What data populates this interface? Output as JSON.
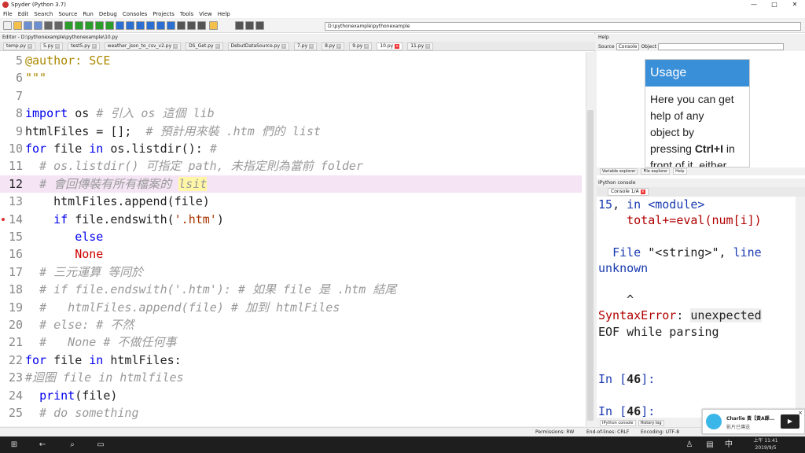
{
  "window": {
    "title": "Spyder (Python 3.7)",
    "controls": [
      "—",
      "□",
      "✕"
    ]
  },
  "menu": [
    "File",
    "Edit",
    "Search",
    "Source",
    "Run",
    "Debug",
    "Consoles",
    "Projects",
    "Tools",
    "View",
    "Help"
  ],
  "toolbar": {
    "path": "D:\\pythonexample\\pythonexample",
    "icons": [
      "new-file",
      "open",
      "save",
      "save-all",
      "browse-tabs",
      "at",
      "run",
      "run-cell",
      "run-cell-advance",
      "run-selection",
      "re-run",
      "debug",
      "step",
      "step-into",
      "step-return",
      "continue",
      "stop",
      "maximize",
      "fullscreen",
      "preferences",
      "python-path",
      "back",
      "forward",
      "up"
    ]
  },
  "editor": {
    "pane_title": "Editor - D:\\pythonexample\\pythonexample\\10.py",
    "tabs": [
      {
        "label": "temp.py",
        "active": false
      },
      {
        "label": "5.py",
        "active": false
      },
      {
        "label": "test5.py",
        "active": false
      },
      {
        "label": "weather_json_to_csv_v2.py",
        "active": false
      },
      {
        "label": "DS_Get.py",
        "active": false
      },
      {
        "label": "DebutDataSource.py",
        "active": false
      },
      {
        "label": "7.py",
        "active": false
      },
      {
        "label": "8.py",
        "active": false
      },
      {
        "label": "9.py",
        "active": false
      },
      {
        "label": "10.py",
        "active": true
      },
      {
        "label": "11.py",
        "active": false
      }
    ],
    "lines": [
      {
        "n": "5",
        "html": "<span class='dec'>@author: SCE</span>"
      },
      {
        "n": "6",
        "html": "<span class='dec'>\"\"\"</span>"
      },
      {
        "n": "7",
        "html": ""
      },
      {
        "n": "8",
        "html": "<span class='kw'>import</span> os <span class='cm'># 引入 os 這個 lib</span>"
      },
      {
        "n": "9",
        "html": "htmlFiles = [];  <span class='cm'># 預計用來裝 .htm 們的 list</span>"
      },
      {
        "n": "10",
        "html": "<span class='kw'>for</span> file <span class='kw'>in</span> os.listdir(): <span class='cm'>#</span>"
      },
      {
        "n": "11",
        "html": "  <span class='cm'># os.listdir() 可指定 path, 未指定則為當前 folder</span>"
      },
      {
        "n": "12",
        "html": "  <span class='cm'># 會回傳裝有所有檔案的 <span class='lsit'>lsit</span></span>",
        "hl": true
      },
      {
        "n": "13",
        "html": "    htmlFiles.append(file)"
      },
      {
        "n": "14",
        "html": "    <span class='kw'>if</span> file.endswith(<span class='str'>'.htm'</span>)",
        "bp": true
      },
      {
        "n": "15",
        "html": "       <span class='kw'>else</span>"
      },
      {
        "n": "16",
        "html": "       <span class='var'>None</span>"
      },
      {
        "n": "17",
        "html": "  <span class='cm'># 三元運算 等同於</span>"
      },
      {
        "n": "18",
        "html": "  <span class='cm'># if file.endswith('.htm'): # 如果 file 是 .htm 結尾</span>"
      },
      {
        "n": "19",
        "html": "  <span class='cm'>#   htmlFiles.append(file) # 加到 htmlFiles</span>"
      },
      {
        "n": "20",
        "html": "  <span class='cm'># else: # 不然</span>"
      },
      {
        "n": "21",
        "html": "  <span class='cm'>#   None # 不做任何事</span>"
      },
      {
        "n": "22",
        "html": "<span class='kw'>for</span> file <span class='kw'>in</span> htmlFiles:"
      },
      {
        "n": "23",
        "html": "<span class='cm'>#迴圈 file in htmlfiles</span>"
      },
      {
        "n": "24",
        "html": "  <span class='kw'>print</span>(file)"
      },
      {
        "n": "25",
        "html": "  <span class='cm'># do something</span>"
      }
    ]
  },
  "help": {
    "pane_title": "Help",
    "source_label": "Source",
    "source_value": "Console",
    "object_label": "Object",
    "usage_title": "Usage",
    "usage_text_1": "Here you can get",
    "usage_text_2": "help of any",
    "usage_text_3": "object by",
    "usage_text_4a": "pressing ",
    "usage_text_4b": "Ctrl+I",
    "usage_text_4c": " in",
    "usage_text_5": "front of it, either",
    "tabs": [
      "Variable explorer",
      "File explorer",
      "Help"
    ]
  },
  "console": {
    "pane_title": "IPython console",
    "tab_label": "Console 1/A",
    "rows": [
      {
        "html": "<span class='cblue'>15</span>, <span class='cblue'>in</span> <span class='cblue'>&lt;module&gt;</span>"
      },
      {
        "html": "    <span class='cerr'>total+=eval(num[i])</span>"
      },
      {
        "html": ""
      },
      {
        "html": "  <span class='cblue'>File</span> \"&lt;string&gt;\", <span class='cblue'>line</span>"
      },
      {
        "html": "<span class='cblue'>unknown</span>"
      },
      {
        "html": ""
      },
      {
        "html": "    ^"
      },
      {
        "html": "<span class='cerr'>SyntaxError</span>: <span class='cbg'>unexpected</span>"
      },
      {
        "html": "EOF while parsing"
      },
      {
        "html": ""
      },
      {
        "html": ""
      },
      {
        "html": "<span class='cblue'>In [</span><b>46</b><span class='cblue'>]:</span>"
      },
      {
        "html": ""
      },
      {
        "html": "<span class='cblue'>In [</span><b>46</b><span class='cblue'>]:</span>"
      }
    ],
    "bottom_tabs": [
      "IPython console",
      "History log"
    ]
  },
  "status": {
    "permissions": "Permissions: RW",
    "eol": "End-of-lines: CRLF",
    "encoding": "Encoding: UTF-8"
  },
  "notification": {
    "name": "Charlie 黃【黃A課...",
    "subtitle": "影片已傳送"
  },
  "taskbar": {
    "time": "上午 11:41",
    "date": "2019/9/5"
  }
}
